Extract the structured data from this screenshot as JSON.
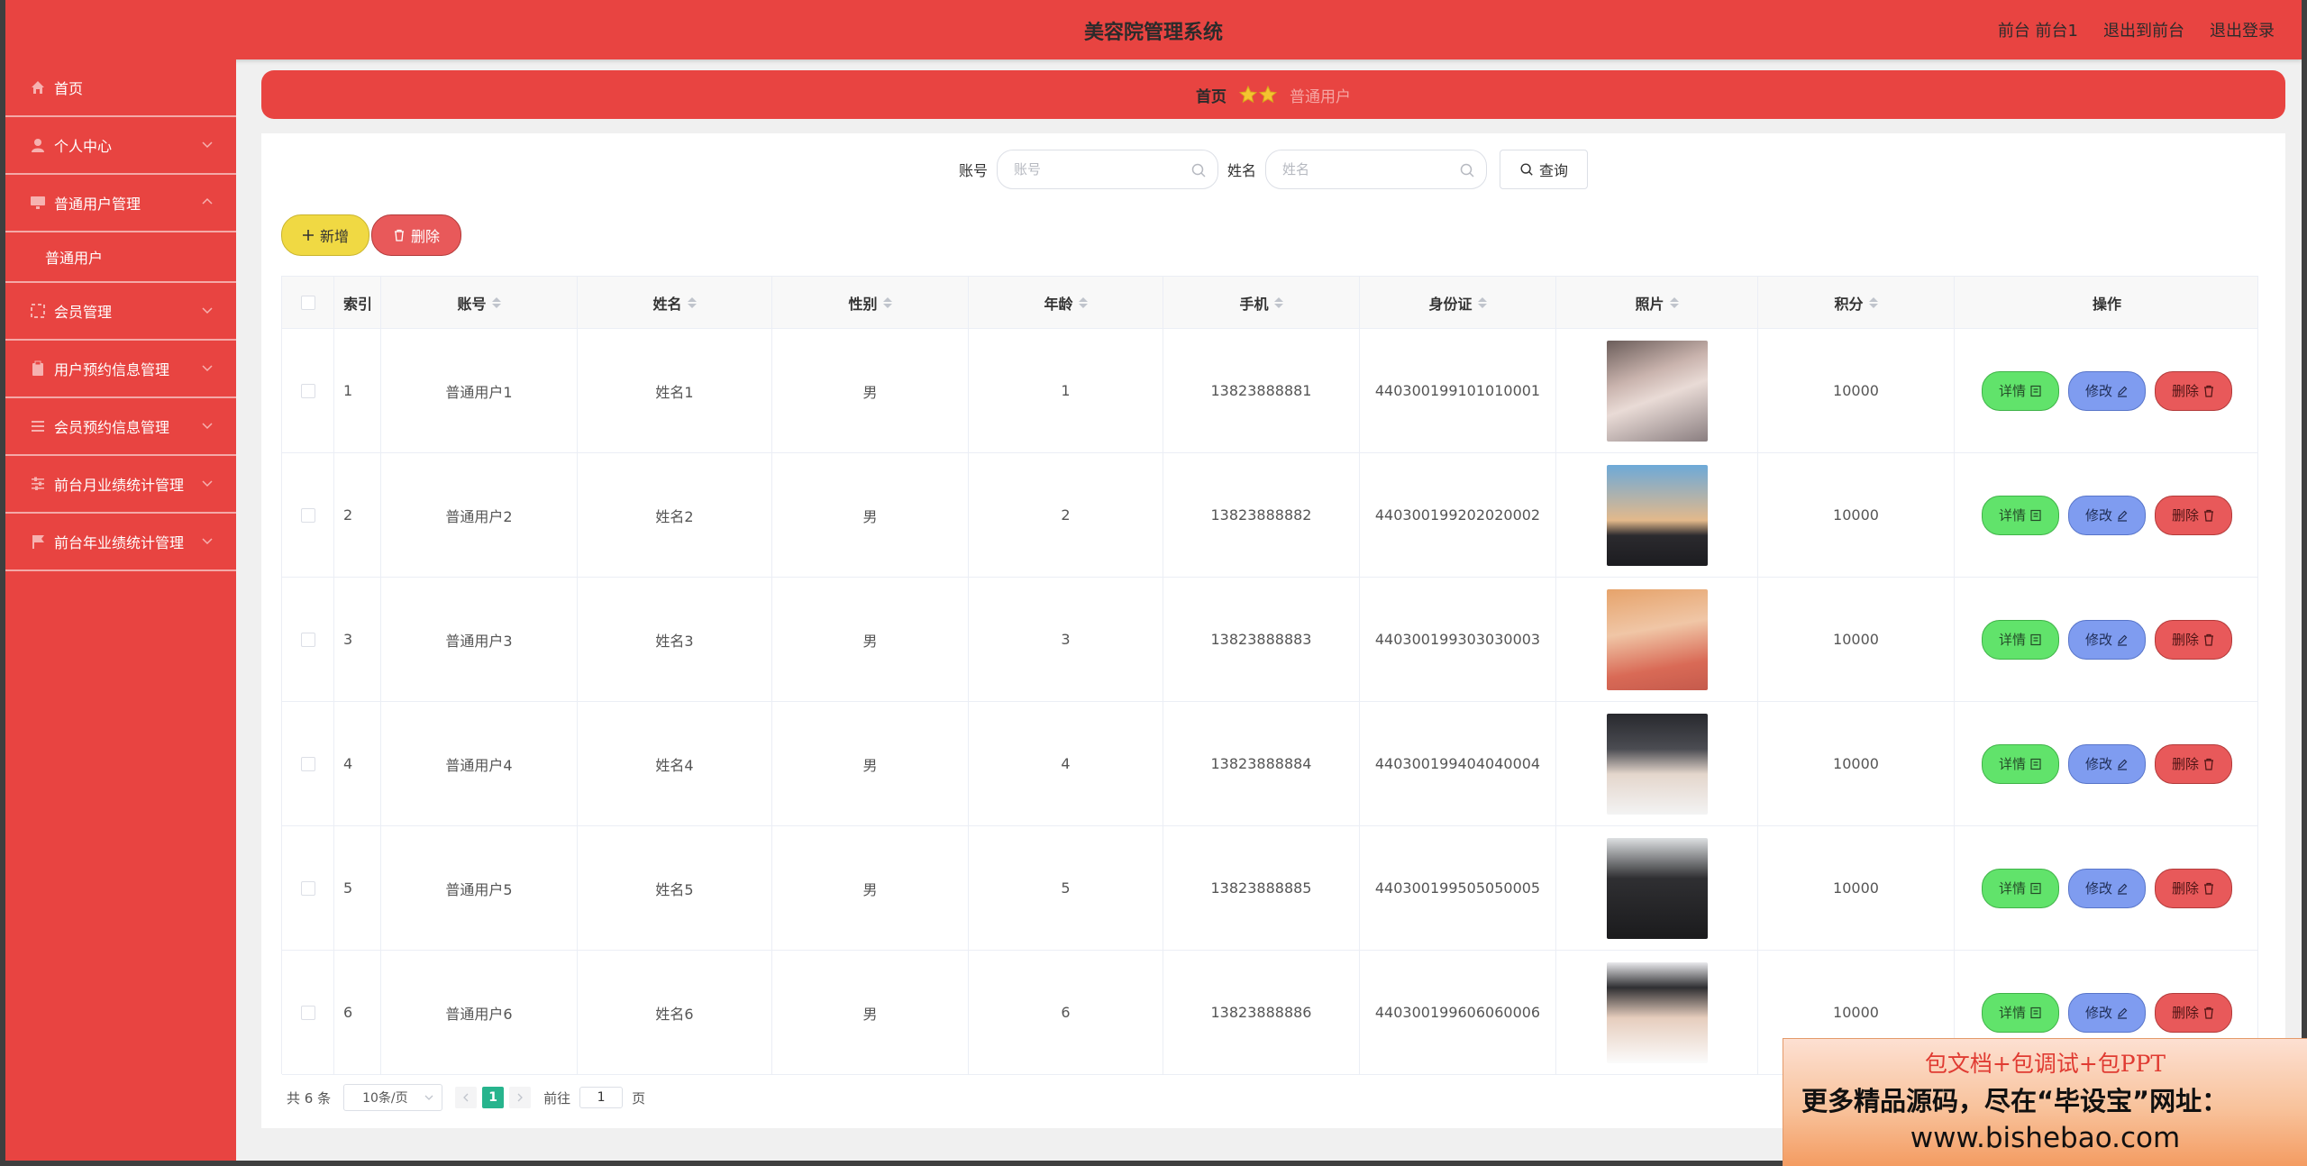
{
  "header": {
    "title": "美容院管理系统",
    "links": [
      "前台 前台1",
      "退出到前台",
      "退出登录"
    ]
  },
  "sidebar": {
    "items": [
      {
        "label": "首页",
        "icon": "home-icon"
      },
      {
        "label": "个人中心",
        "icon": "user-icon"
      },
      {
        "label": "普通用户管理",
        "icon": "monitor-icon",
        "expanded": true
      },
      {
        "label": "会员管理",
        "icon": "crop-icon"
      },
      {
        "label": "用户预约信息管理",
        "icon": "clipboard-icon"
      },
      {
        "label": "会员预约信息管理",
        "icon": "list-icon"
      },
      {
        "label": "前台月业绩统计管理",
        "icon": "sliders-icon"
      },
      {
        "label": "前台年业绩统计管理",
        "icon": "flag-icon"
      }
    ],
    "subitem": "普通用户"
  },
  "breadcrumb": {
    "home": "首页",
    "current": "普通用户"
  },
  "search": {
    "account_label": "账号",
    "account_placeholder": "账号",
    "name_label": "姓名",
    "name_placeholder": "姓名",
    "query_label": "查询"
  },
  "actions": {
    "add_label": "新增",
    "delete_label": "删除"
  },
  "table": {
    "headers": [
      "索引",
      "账号",
      "姓名",
      "性别",
      "年龄",
      "手机",
      "身份证",
      "照片",
      "积分",
      "操作"
    ],
    "rows": [
      {
        "index": "1",
        "account": "普通用户1",
        "name": "姓名1",
        "gender": "男",
        "age": "1",
        "phone": "13823888881",
        "id_card": "440300199101010001",
        "points": "10000"
      },
      {
        "index": "2",
        "account": "普通用户2",
        "name": "姓名2",
        "gender": "男",
        "age": "2",
        "phone": "13823888882",
        "id_card": "440300199202020002",
        "points": "10000"
      },
      {
        "index": "3",
        "account": "普通用户3",
        "name": "姓名3",
        "gender": "男",
        "age": "3",
        "phone": "13823888883",
        "id_card": "440300199303030003",
        "points": "10000"
      },
      {
        "index": "4",
        "account": "普通用户4",
        "name": "姓名4",
        "gender": "男",
        "age": "4",
        "phone": "13823888884",
        "id_card": "440300199404040004",
        "points": "10000"
      },
      {
        "index": "5",
        "account": "普通用户5",
        "name": "姓名5",
        "gender": "男",
        "age": "5",
        "phone": "13823888885",
        "id_card": "440300199505050005",
        "points": "10000"
      },
      {
        "index": "6",
        "account": "普通用户6",
        "name": "姓名6",
        "gender": "男",
        "age": "6",
        "phone": "13823888886",
        "id_card": "440300199606060006",
        "points": "10000"
      }
    ],
    "op_detail": "详情",
    "op_edit": "修改",
    "op_delete": "删除"
  },
  "pagination": {
    "total": "共 6 条",
    "page_size": "10条/页",
    "current_page": "1",
    "goto_label": "前往",
    "goto_value": "1",
    "page_suffix": "页"
  },
  "watermark": {
    "line1": "包文档+包调试+包PPT",
    "line2": "更多精品源码，尽在“毕设宝”网址：",
    "line3": "www.bishebao.com"
  },
  "colors": {
    "primary": "#e84441",
    "add": "#f0d943",
    "detail": "#61e36b",
    "edit": "#7f9cf0",
    "delete": "#e8595a",
    "page_active": "#27b48d"
  }
}
